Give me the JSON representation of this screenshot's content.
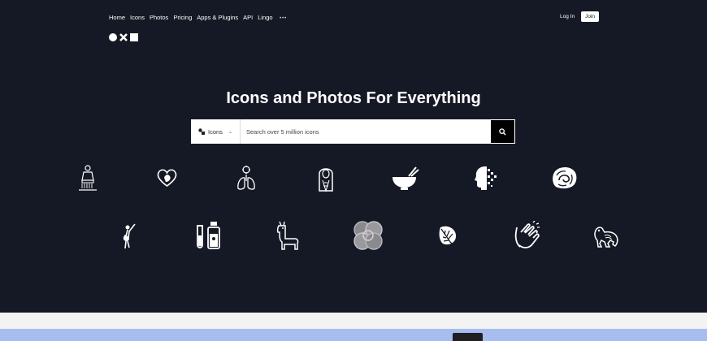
{
  "nav": {
    "items": [
      "Home",
      "Icons",
      "Photos",
      "Pricing",
      "Apps & Plugins",
      "API",
      "Lingo"
    ],
    "more": "⋯"
  },
  "auth": {
    "login": "Log In",
    "join": "Join"
  },
  "hero": {
    "title": "Icons and Photos For Everything"
  },
  "search": {
    "type_label": "Icons",
    "placeholder": "Search over 5 million icons"
  },
  "icons_row1": [
    "statue-icon",
    "heart-planet-icon",
    "lungs-virus-icon",
    "virgin-mary-icon",
    "bowl-chopsticks-icon",
    "ai-head-icon",
    "brain-swirl-icon"
  ],
  "icons_row2": [
    "dancer-icon",
    "test-tubes-icon",
    "llama-icon",
    "rings-knot-icon",
    "monstera-leaf-icon",
    "clapping-hands-icon",
    "tribal-animal-icon"
  ],
  "colors": {
    "background": "#151925",
    "cookie_bar": "#a7bdf0"
  }
}
